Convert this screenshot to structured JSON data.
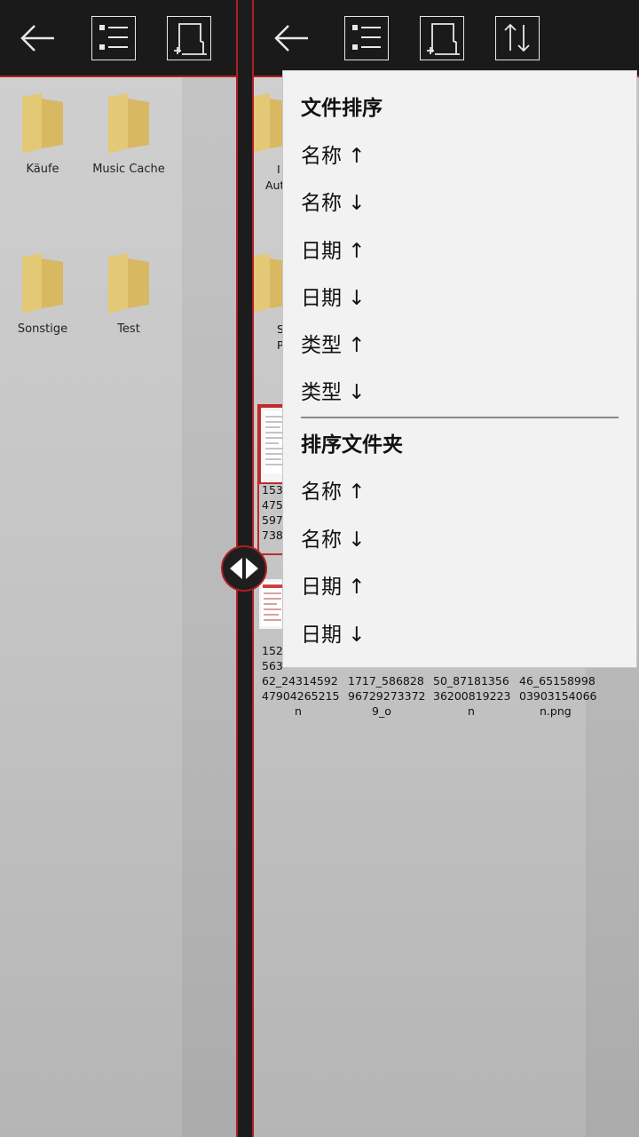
{
  "left_pane": {
    "folders": [
      {
        "label": "Käufe"
      },
      {
        "label": "Music Cache"
      },
      {
        "label": "Sonstige"
      },
      {
        "label": "Test"
      }
    ]
  },
  "right_pane": {
    "partial_labels": [
      "I",
      "Aut",
      "S",
      "P"
    ],
    "file_fragments": {
      "row1": [
        "153",
        "475",
        "597",
        "738"
      ],
      "row2_col1": [
        "152",
        "563",
        "62_24314592",
        "47904265215",
        "n"
      ],
      "row2_col2": [
        "1717_586828",
        "96729273372",
        "9_o"
      ],
      "row2_col3": [
        "50_87181356",
        "36200819223",
        "n"
      ],
      "row2_col4": [
        "46_65158998",
        "03903154066",
        "n.png"
      ]
    }
  },
  "toolbar": {
    "icons": [
      "back-arrow-icon",
      "list-view-icon",
      "new-folder-icon",
      "sort-icon"
    ]
  },
  "sort_menu": {
    "file_sort_header": "文件排序",
    "file_sort_items": [
      "名称 ↑",
      "名称 ↓",
      "日期 ↑",
      "日期 ↓",
      "类型 ↑",
      "类型 ↓"
    ],
    "folder_sort_header": "排序文件夹",
    "folder_sort_items": [
      "名称 ↑",
      "名称 ↓",
      "日期 ↑",
      "日期 ↓"
    ]
  },
  "colors": {
    "accent": "#b01e24",
    "toolbar_bg": "#1a1a1a",
    "folder": "#e0c372",
    "menu_bg": "#f2f2f2"
  }
}
